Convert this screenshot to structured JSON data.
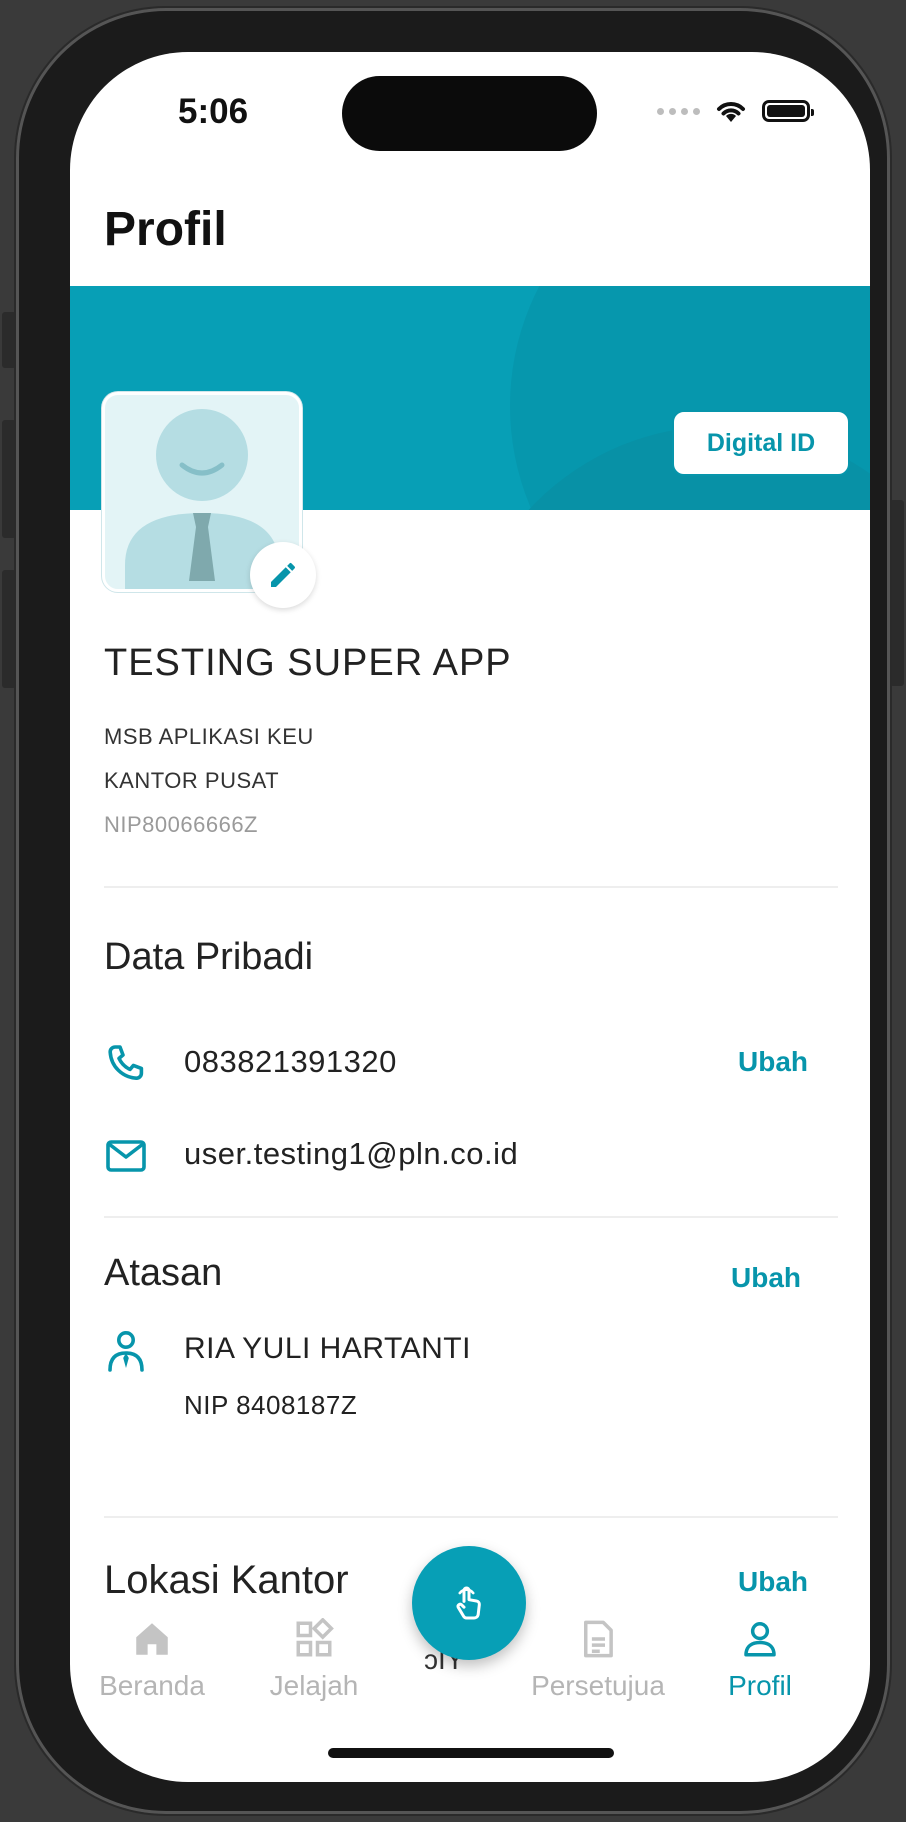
{
  "status_bar": {
    "time": "5:06"
  },
  "header": {
    "title": "Profil"
  },
  "profile": {
    "digital_id_label": "Digital ID",
    "name": "TESTING SUPER APP",
    "unit": "MSB APLIKASI KEU",
    "office": "KANTOR PUSAT",
    "nip": "NIP80066666Z"
  },
  "data_pribadi": {
    "title": "Data Pribadi",
    "phone": "083821391320",
    "phone_edit": "Ubah",
    "email": "user.testing1@pln.co.id"
  },
  "atasan": {
    "title": "Atasan",
    "edit": "Ubah",
    "name": "RIA YULI HARTANTI",
    "nip": "NIP 8408187Z"
  },
  "lokasi_kantor": {
    "title": "Lokasi Kantor",
    "edit": "Ubah"
  },
  "bottom_nav": {
    "items": [
      {
        "label": "Beranda",
        "icon": "home-icon"
      },
      {
        "label": "Jelajah",
        "icon": "grid-icon"
      },
      {
        "label": "Persetujua",
        "icon": "document-icon"
      },
      {
        "label": "Profil",
        "icon": "person-icon",
        "active": true
      }
    ],
    "fab_icon": "touch-icon",
    "fab_partial_label": "ͻIY"
  },
  "colors": {
    "accent": "#079fb6",
    "text": "#222222",
    "muted": "#b5b5b5"
  }
}
